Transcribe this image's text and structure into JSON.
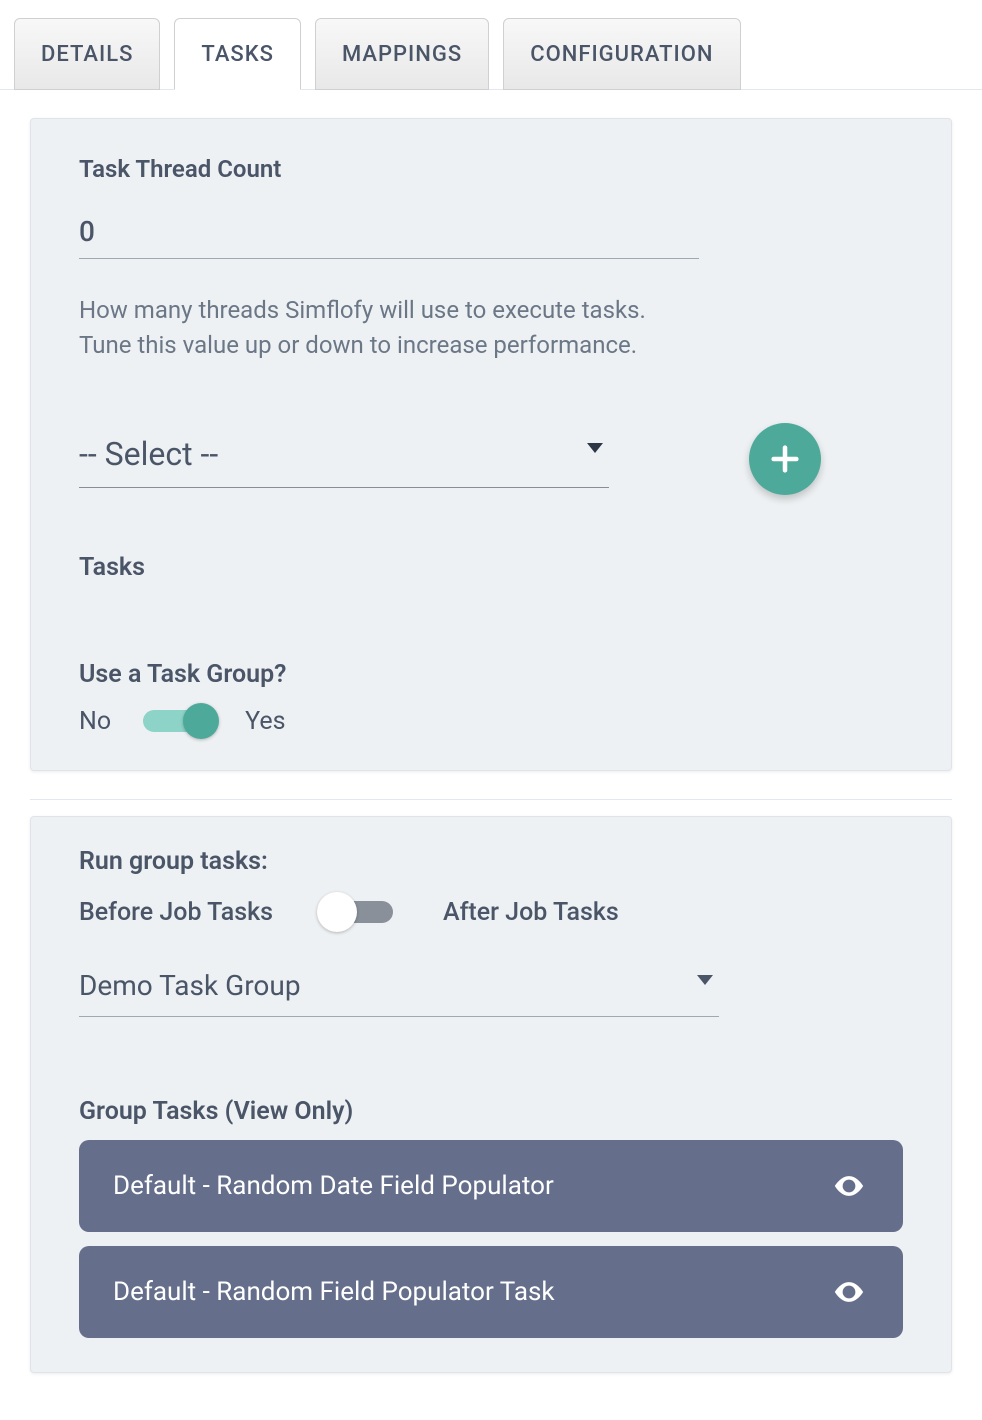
{
  "tabs": {
    "details": "DETAILS",
    "tasks": "TASKS",
    "mappings": "MAPPINGS",
    "configuration": "CONFIGURATION"
  },
  "card1": {
    "thread_count_label": "Task Thread Count",
    "thread_count_value": "0",
    "thread_count_help": "How many threads Simflofy will use to execute tasks. Tune this value up or down to increase performance.",
    "select_placeholder": "-- Select --",
    "tasks_label": "Tasks",
    "use_group_label": "Use a Task Group?",
    "toggle_no": "No",
    "toggle_yes": "Yes"
  },
  "card2": {
    "run_group_label": "Run group tasks:",
    "before_label": "Before Job Tasks",
    "after_label": "After Job Tasks",
    "group_select_value": "Demo Task Group",
    "group_view_label": "Group Tasks (View Only)",
    "items": [
      "Default - Random Date Field Populator",
      "Default - Random Field Populator Task"
    ]
  }
}
